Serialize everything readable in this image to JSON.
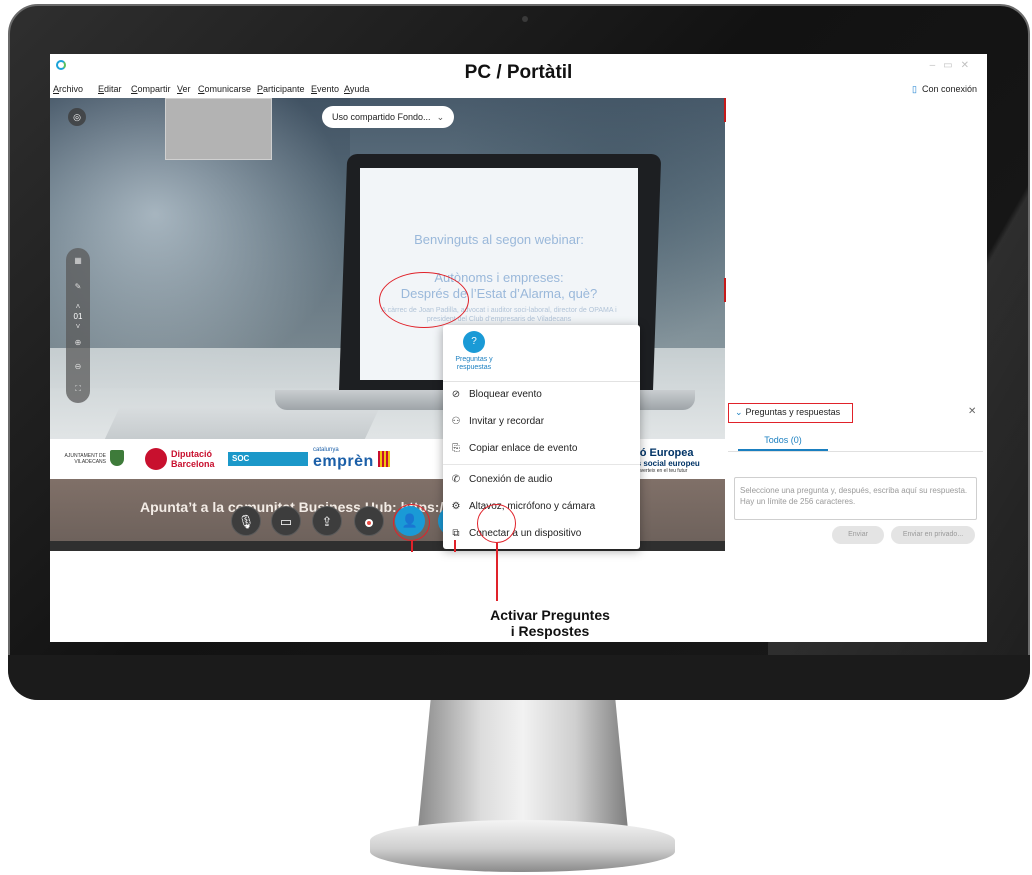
{
  "overlay": {
    "title": "PC / Portàtil",
    "callout_line1": "Activar Preguntes",
    "callout_line2": "i Respostes"
  },
  "menu": [
    "Archivo",
    "Editar",
    "Compartir",
    "Ver",
    "Comunicarse",
    "Participante",
    "Evento",
    "Ayuda"
  ],
  "status": {
    "connection": "Con conexión"
  },
  "video": {
    "sharing_label": "Uso compartido Fondo...",
    "slide": {
      "line1": "Benvinguts al segon webinar:",
      "line2": "Autònoms i empreses:",
      "line3": "Després de l’Estat d’Alarma, què?",
      "line4": "A càrrec de Joan Padilla, advocat i auditor soci-laboral, director de OPAMA i president del Club d’empresaris de Viladecans"
    },
    "left_toolbar_page": "01",
    "banner": "Apunta’t a la comunitat Business Hub: https://businesshub.viladecans.cat"
  },
  "logos": {
    "viladecans": "AJUNTAMENT DE VILADECANS",
    "diputacio_1": "Diputació",
    "diputacio_2": "Barcelona",
    "soc": "SOC",
    "catalunya_small": "catalunya",
    "catalunya_big": "emprèn",
    "eu_1": "Unió Europea",
    "eu_2": "Fons social europeu",
    "eu_3": "L’FSE inverteix en el teu futur"
  },
  "popup": {
    "tile_label": "Preguntas y respuestas",
    "items": [
      "Bloquear evento",
      "Invitar y recordar",
      "Copiar enlace de evento",
      "Conexión de audio",
      "Altavoz, micrófono y cámara",
      "Conectar a un dispositivo"
    ]
  },
  "panel": {
    "header": "Preguntas y respuestas",
    "tab_all": "Todos (0)",
    "input_placeholder": "Seleccione una pregunta y, después, escriba aquí su respuesta. Hay un límite de 256 caracteres.",
    "send": "Enviar",
    "send_private": "Enviar en privado..."
  },
  "colors": {
    "accent_blue": "#1a9ad6",
    "annotation_red": "#e0222a",
    "leave_red": "#ec4d45"
  },
  "icons": {
    "controls": [
      "mute-icon",
      "video-icon",
      "share-icon",
      "record-icon",
      "participants-icon",
      "chat-icon",
      "more-options-icon",
      "leave-icon"
    ]
  }
}
